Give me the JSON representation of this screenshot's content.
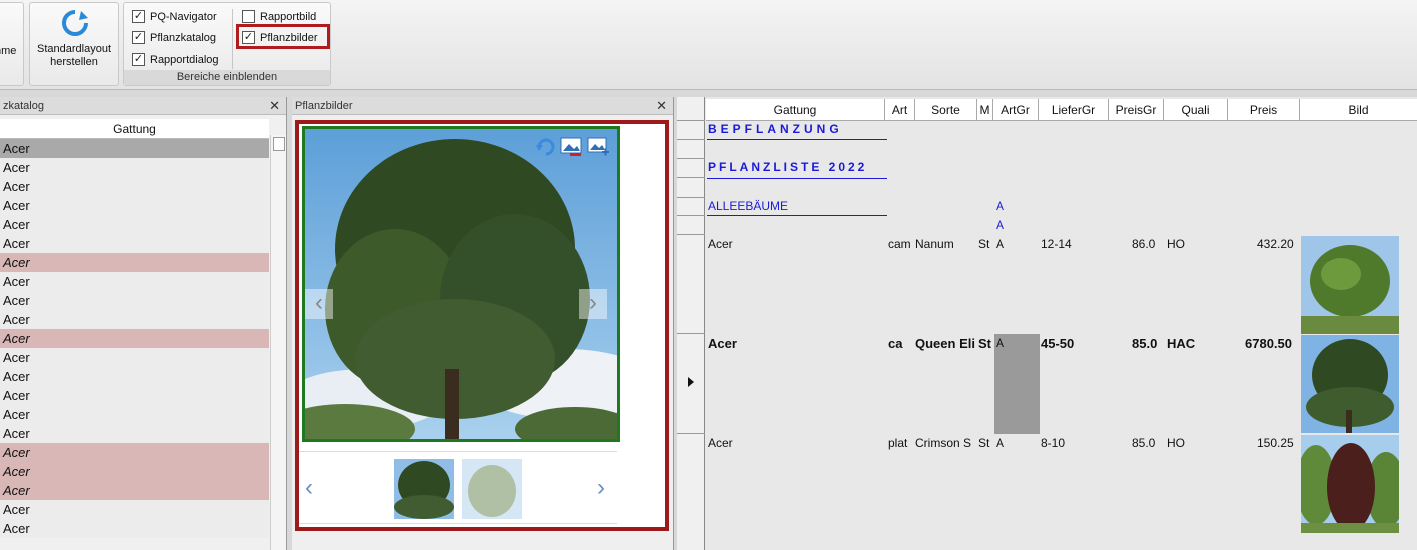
{
  "ribbon": {
    "partial_button_label": "nme",
    "standard_layout_button": "Standardlayout\nherstellen",
    "group_label": "Bereiche einblenden",
    "checkboxes": [
      {
        "label": "PQ-Navigator",
        "checked": true
      },
      {
        "label": "Pflanzkatalog",
        "checked": true
      },
      {
        "label": "Rapportdialog",
        "checked": true
      },
      {
        "label": "Rapportbild",
        "checked": false
      },
      {
        "label": "Pflanzbilder",
        "checked": true
      }
    ]
  },
  "left_panel": {
    "title": "zkatalog",
    "column": "Gattung",
    "items": [
      "Acer",
      "Acer",
      "Acer",
      "Acer",
      "Acer",
      "Acer",
      "Acer",
      "Acer",
      "Acer",
      "Acer",
      "Acer",
      "Acer",
      "Acer",
      "Acer",
      "Acer",
      "Acer",
      "Acer",
      "Acer",
      "Acer",
      "Acer",
      "Acer"
    ]
  },
  "mid_panel": {
    "title": "Pflanzbilder"
  },
  "grid": {
    "columns": [
      "Gattung",
      "Art",
      "Sorte",
      "M",
      "ArtGr",
      "LieferGr",
      "PreisGr",
      "Quali",
      "Preis",
      "Bild"
    ],
    "section1": "BEPFLANZUNG",
    "section2": "PFLANZLISTE 2022",
    "section3": "ALLEEBÄUME",
    "a1": "A",
    "a2": "A",
    "rows": [
      {
        "gattung": "Acer",
        "art": "cam",
        "sorte": "Nanum",
        "m": "St",
        "artgr": "A",
        "liefergr": "12-14",
        "preisgr": "86.0",
        "quali": "HO",
        "preis": "432.20"
      },
      {
        "gattung": "Acer",
        "art": "ca",
        "sorte": "Queen Eli",
        "m": "St",
        "artgr": "A",
        "liefergr": "45-50",
        "preisgr": "85.0",
        "quali": "HAC",
        "preis": "6780.50"
      },
      {
        "gattung": "Acer",
        "art": "plat",
        "sorte": "Crimson S",
        "m": "St",
        "artgr": "A",
        "liefergr": "8-10",
        "preisgr": "85.0",
        "quali": "HO",
        "preis": "150.25"
      }
    ]
  }
}
